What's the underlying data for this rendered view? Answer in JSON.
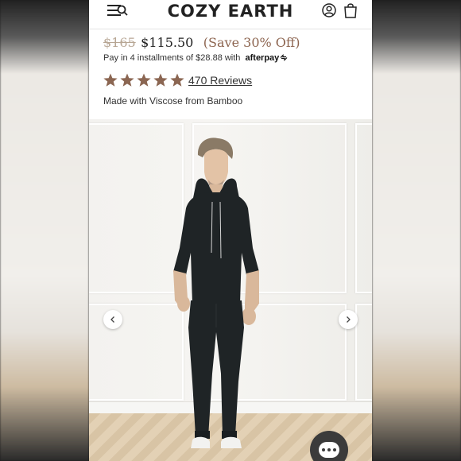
{
  "header": {
    "brand": "COZY EARTH",
    "icons": [
      "menu-search-icon",
      "account-icon",
      "cart-icon"
    ]
  },
  "product": {
    "price_original": "$165",
    "price_sale": "$115.50",
    "savings": "(Save 30% Off)",
    "installments_text": "Pay in 4 installments of $28.88 with",
    "afterpay_label": "afterpay",
    "rating_stars": 5,
    "reviews_link": "470 Reviews",
    "material": "Made with Viscose from Bamboo"
  },
  "gallery": {
    "prev_icon": "chevron-left-icon",
    "next_icon": "chevron-right-icon",
    "chat_icon": "chat-icon"
  },
  "colors": {
    "star": "#8b6652",
    "savings": "#8d6550",
    "strike_price": "#b7a694",
    "garment": "#1f2426"
  }
}
